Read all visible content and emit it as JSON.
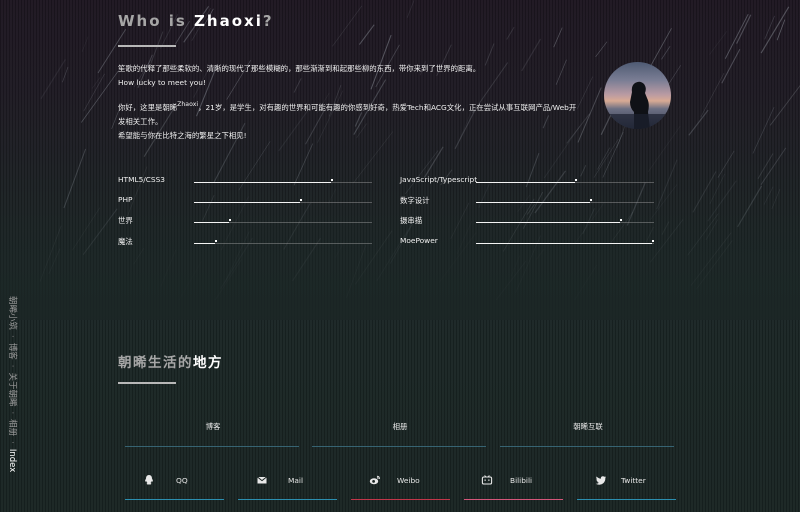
{
  "about": {
    "title_prefix": "Who is ",
    "title_name": "Zhaoxi",
    "title_suffix": "?",
    "intro_lines": [
      "笙歌的代释了那些柔软的、清晰的现代了那些模糊的，那些渐渐到和起那些柳的东西，带你来到了世界的距离。",
      "How lucky to meet you!",
      "你好，这里是朝晞",
      "，21岁，是学生，对有趣的世界和可能有趣的你感到好奇，热爱Tech和ACG文化，正在尝试从事互联网产品/Web开",
      "发相关工作。",
      "希望能与你在比特之海的繁星之下相见!"
    ],
    "name_sup": "Zhaoxi"
  },
  "skills": [
    {
      "label": "HTML5/CSS3",
      "value": 0.78,
      "col": 0,
      "row": 0
    },
    {
      "label": "JavaScript/Typescript",
      "value": 0.56,
      "col": 1,
      "row": 0
    },
    {
      "label": "PHP",
      "value": 0.6,
      "col": 0,
      "row": 1
    },
    {
      "label": "数字设计",
      "value": 0.65,
      "col": 1,
      "row": 1
    },
    {
      "label": "世界",
      "value": 0.2,
      "col": 0,
      "row": 2
    },
    {
      "label": "摄串描",
      "value": 0.82,
      "col": 1,
      "row": 2
    },
    {
      "label": "魔法",
      "value": 0.12,
      "col": 0,
      "row": 3
    },
    {
      "label": "MoePower",
      "value": 1.0,
      "col": 1,
      "row": 3
    }
  ],
  "places": {
    "title_dim": "朝晞生活的",
    "title_bright": "地方",
    "categories": [
      "博客",
      "相册",
      "朝晞互联"
    ],
    "socials": [
      {
        "name": "QQ",
        "icon": "qq-icon",
        "color": "#2c8fb0"
      },
      {
        "name": "Mail",
        "icon": "mail-icon",
        "color": "#2c8fb0"
      },
      {
        "name": "Weibo",
        "icon": "weibo-icon",
        "color": "#c2364a"
      },
      {
        "name": "Bilibili",
        "icon": "bilibili-icon",
        "color": "#d4567a"
      },
      {
        "name": "Twitter",
        "icon": "twitter-icon",
        "color": "#2c8fb0"
      }
    ]
  },
  "side_nav": {
    "items": [
      "朝晞小筑",
      "博客",
      "关于朝晞",
      "相册",
      "Index"
    ],
    "separator": "·",
    "active_index": 4
  }
}
